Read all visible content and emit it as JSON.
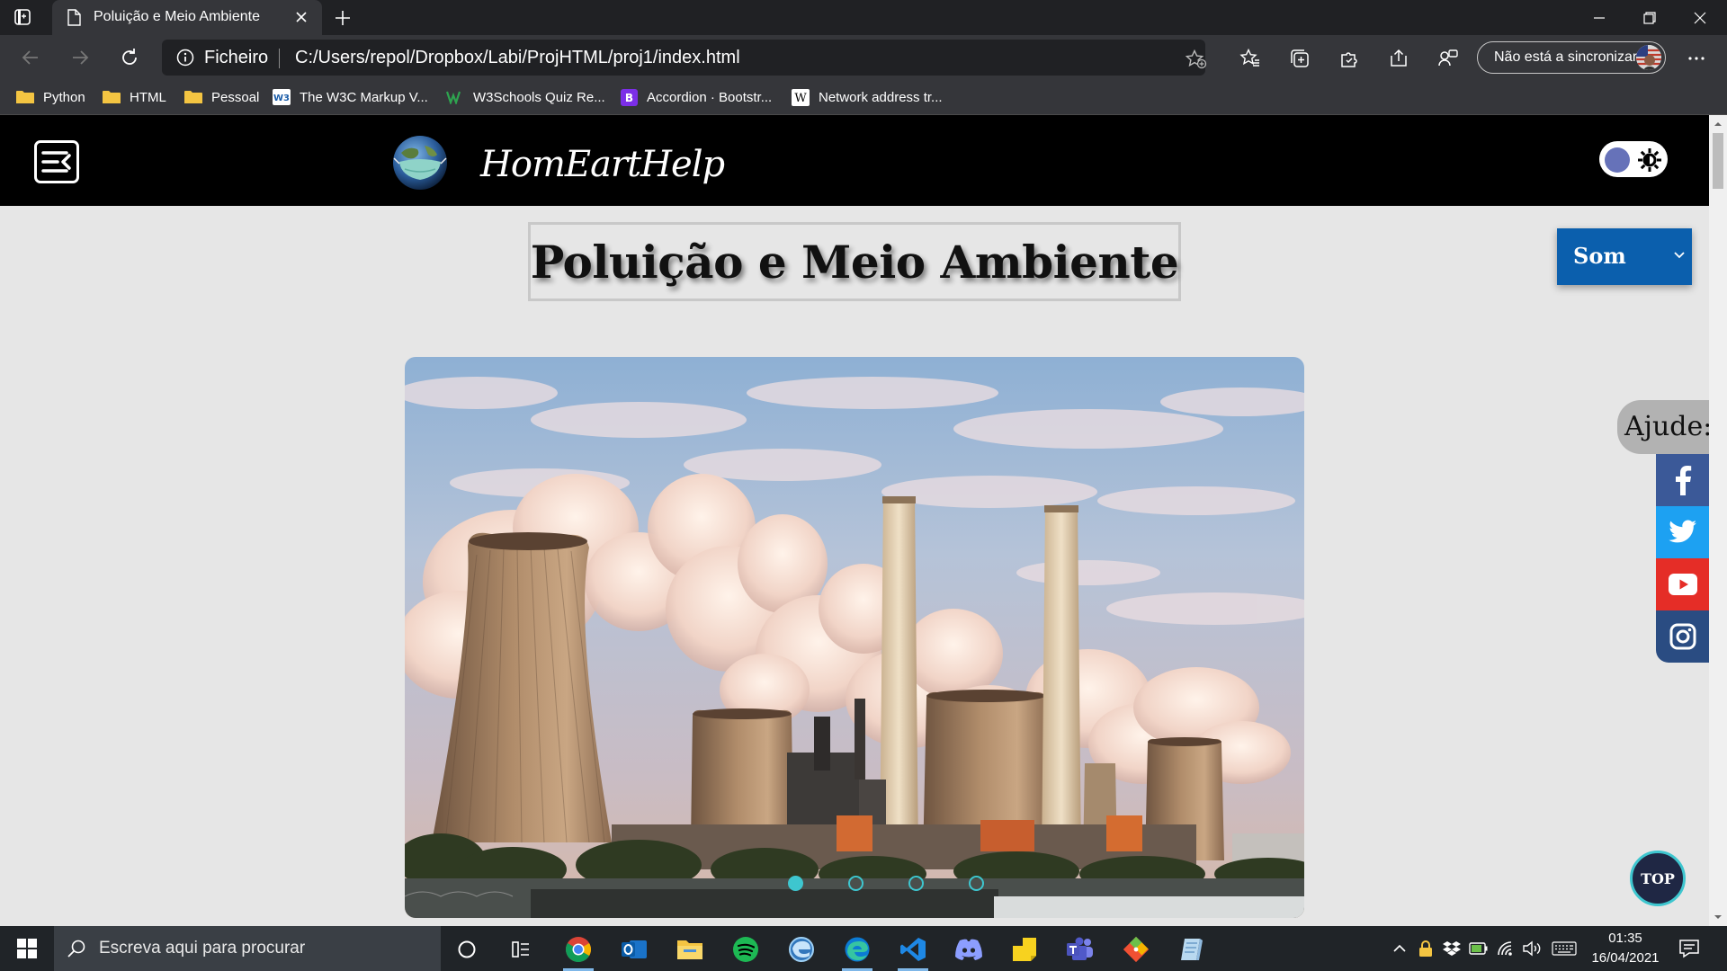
{
  "browser": {
    "tab": {
      "title": "Poluição e Meio Ambiente"
    },
    "omnibox": {
      "site_label": "Ficheiro",
      "url": "C:/Users/repol/Dropbox/Labi/ProjHTML/proj1/index.html"
    },
    "sync_label": "Não está a sincronizar",
    "bookmarks": [
      {
        "label": "Python",
        "icon": "folder-icon"
      },
      {
        "label": "HTML",
        "icon": "folder-icon"
      },
      {
        "label": "Pessoal",
        "icon": "folder-icon"
      },
      {
        "label": "The W3C Markup V...",
        "icon": "w3c-icon"
      },
      {
        "label": "W3Schools Quiz Re...",
        "icon": "w3schools-icon"
      },
      {
        "label": "Accordion · Bootstr...",
        "icon": "bootstrap-icon"
      },
      {
        "label": "Network address tr...",
        "icon": "wikipedia-icon"
      }
    ]
  },
  "page": {
    "brand": "HomEartHelp",
    "title": "Poluição e Meio Ambiente",
    "sound_select": {
      "selected": "Som"
    },
    "carousel": {
      "slide_count": 4,
      "active_slide": 1
    },
    "help_label": "Ajude:",
    "social": [
      "facebook",
      "twitter",
      "youtube",
      "instagram"
    ],
    "top_button": "TOP",
    "colors": {
      "header": "#000000",
      "background": "#e6e6e6",
      "accent": "#3ec6cf",
      "sound_button": "#0b5fad",
      "facebook": "#3b5998",
      "twitter": "#1da1f2",
      "youtube": "#e52d27",
      "instagram": "#2a4c82"
    }
  },
  "taskbar": {
    "search_placeholder": "Escreva aqui para procurar",
    "time": "01:35",
    "date": "16/04/2021"
  }
}
